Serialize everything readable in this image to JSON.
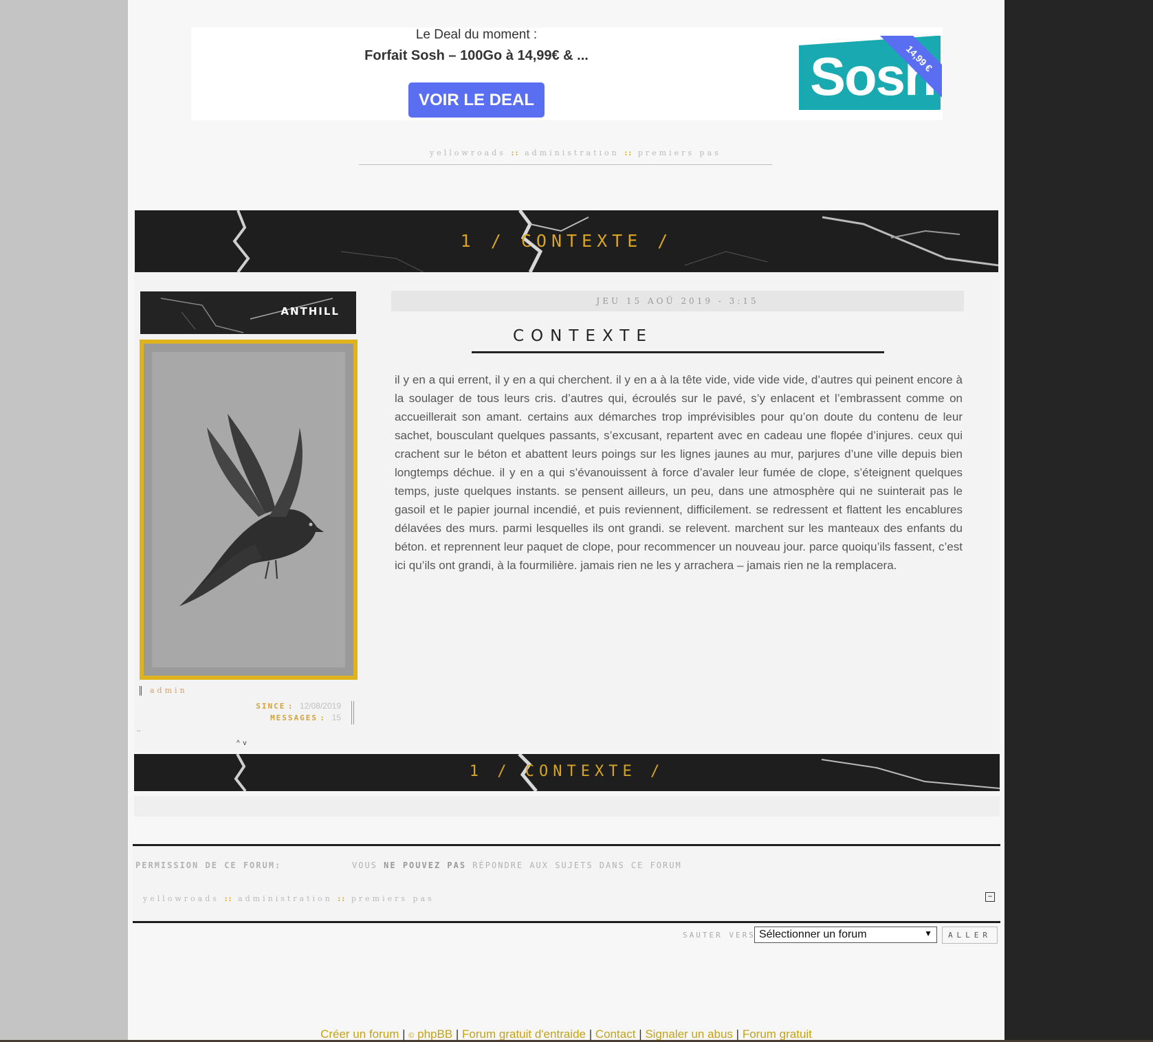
{
  "ad": {
    "caption": "Le Deal du moment :",
    "title": "Forfait Sosh – 100Go à 14,99€ & ...",
    "button": "VOIR LE DEAL",
    "logo_text": "Sosh",
    "ribbon": "14,99 €"
  },
  "breadcrumb": {
    "items": [
      "yellowroads",
      "administration",
      "premiers pas"
    ],
    "separator": "::"
  },
  "topic": {
    "banner_title": "1 / CONTEXTE /"
  },
  "post": {
    "author": "ANTHILL",
    "rank": "admin",
    "since_label": "SINCE",
    "since_value": "12/08/2019",
    "messages_label": "MESSAGES",
    "messages_value": "15",
    "date": "JEU 15 AOÛ 2019 - 3:15",
    "title": "CONTEXTE",
    "body": "il y en a qui errent, il y en a qui cherchent. il y en a à la tête vide, vide vide vide, d’autres qui peinent encore à la soulager de tous leurs cris. d’autres qui, écroulés sur le pavé, s’y enlacent et l’embrassent comme on accueillerait son amant. certains aux démarches trop imprévisibles pour qu’on doute du contenu de leur sachet, bousculant quelques passants, s’excusant, repartent avec en cadeau une flopée d’injures. ceux qui crachent sur le béton et abattent leurs poings sur les lignes jaunes au mur, parjures d’une ville depuis bien longtemps déchue. il y en a qui s’évanouissent à force d’avaler leur fumée de clope, s’éteignent quelques temps, juste quelques instants. se pensent ailleurs, un peu, dans une atmosphère qui ne suinterait pas le gasoil et le papier journal incendié, et puis reviennent, difficilement. se redressent et flattent les encablures délavées des murs. parmi lesquelles ils ont grandi. se relevent. marchent sur les manteaux des enfants du béton. et reprennent leur paquet de clope, pour recommencer un nouveau jour. parce quoiqu’ils fassent, c’est ici qu’ils ont grandi, à la fourmilière. jamais rien ne les y arrachera – jamais rien ne la remplacera."
  },
  "permissions": {
    "label": "PERMISSION DE CE FORUM:",
    "text_pre": "VOUS",
    "text_bold": "NE POUVEZ PAS",
    "text_post": "RÉPONDRE AUX SUJETS DANS CE FORUM"
  },
  "jump": {
    "label": "SAUTER VERS:",
    "selected": "Sélectionner un forum",
    "button": "ALLER"
  },
  "footer": {
    "links": [
      "Créer un forum",
      "phpBB",
      "Forum gratuit d'entraide",
      "Contact",
      "Signaler un abus",
      "Forum gratuit"
    ],
    "copyright_symbol": "©"
  },
  "colors": {
    "accent": "#d7a424",
    "ad_button": "#5a6ef2",
    "sosh": "#19aab1",
    "banner_bg": "#1e1e1e"
  }
}
